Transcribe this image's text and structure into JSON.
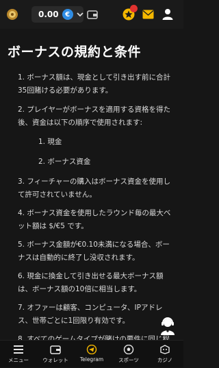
{
  "header": {
    "balance": "0.00",
    "currency_symbol": "€",
    "icons": [
      "logo-icon",
      "euro-icon",
      "chevron-down-icon",
      "wallet-icon",
      "bonus-star-icon",
      "mail-icon",
      "user-icon"
    ],
    "accent": "#f5b800",
    "notification_color": "#e0322f"
  },
  "main": {
    "title": "ボーナスの規約と条件",
    "terms": [
      {
        "lines": [
          "1. ボーナス額は、現金として引き出す前に合計",
          "35回賭ける必要があります。"
        ]
      },
      {
        "lines": [
          "2. プレイヤーがボーナスを適用する資格を得た",
          "後、資金は以下の順序で使用されます:"
        ]
      },
      {
        "lines": [
          "3. フィーチャーの購入はボーナス資金を使用し",
          "て許可されていません。"
        ]
      },
      {
        "lines": [
          "4. ボーナス資金を使用したラウンド毎の最大ベ",
          "ット額は $/€5 です。"
        ]
      },
      {
        "lines": [
          "5. ボーナス金額が€0.10未満になる場合、ボー",
          "ナスは自動的に終了し没収されます。"
        ]
      },
      {
        "lines": [
          "6. 現金に換金して引き出せる最大ボーナス額",
          "は、ボーナス額の10倍に相当します。"
        ]
      },
      {
        "lines": [
          "7. オファーは顧客、コンピュータ、IPアドレ",
          "ス、世帯ごとに1回限り有効です。"
        ]
      },
      {
        "lines": [
          "8. すべてのゲームタイプが賭けの要件に同じ程"
        ]
      }
    ],
    "subterms": [
      "1. 現金",
      "2. ボーナス資金"
    ]
  },
  "bottom_nav": [
    {
      "label": "メニュー",
      "icon": "menu-icon"
    },
    {
      "label": "ウォレット",
      "icon": "wallet-icon"
    },
    {
      "label": "Telegram",
      "icon": "telegram-icon"
    },
    {
      "label": "スポーツ",
      "icon": "sports-ball-icon"
    },
    {
      "label": "カジノ",
      "icon": "casino-icon"
    }
  ]
}
